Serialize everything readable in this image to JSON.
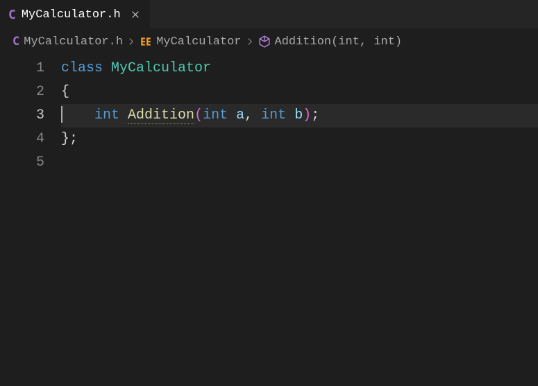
{
  "tab": {
    "filename": "MyCalculator.h",
    "icon_letter": "C"
  },
  "breadcrumb": {
    "file_icon_letter": "C",
    "file": "MyCalculator.h",
    "class": "MyCalculator",
    "method": "Addition(int, int)"
  },
  "line_numbers": [
    "1",
    "2",
    "3",
    "4",
    "5"
  ],
  "active_line": 3,
  "code": {
    "l1": {
      "kw": "class",
      "type": "MyCalculator"
    },
    "l2": {
      "brace": "{"
    },
    "l3": {
      "indent": "    ",
      "kw": "int",
      "fn": "Addition",
      "lp": "(",
      "p1t": "int",
      "p1n": "a",
      "comma": ",",
      "p2t": "int",
      "p2n": "b",
      "rp": ")",
      "semi": ";"
    },
    "l4": {
      "brace": "}",
      "semi": ";"
    }
  }
}
